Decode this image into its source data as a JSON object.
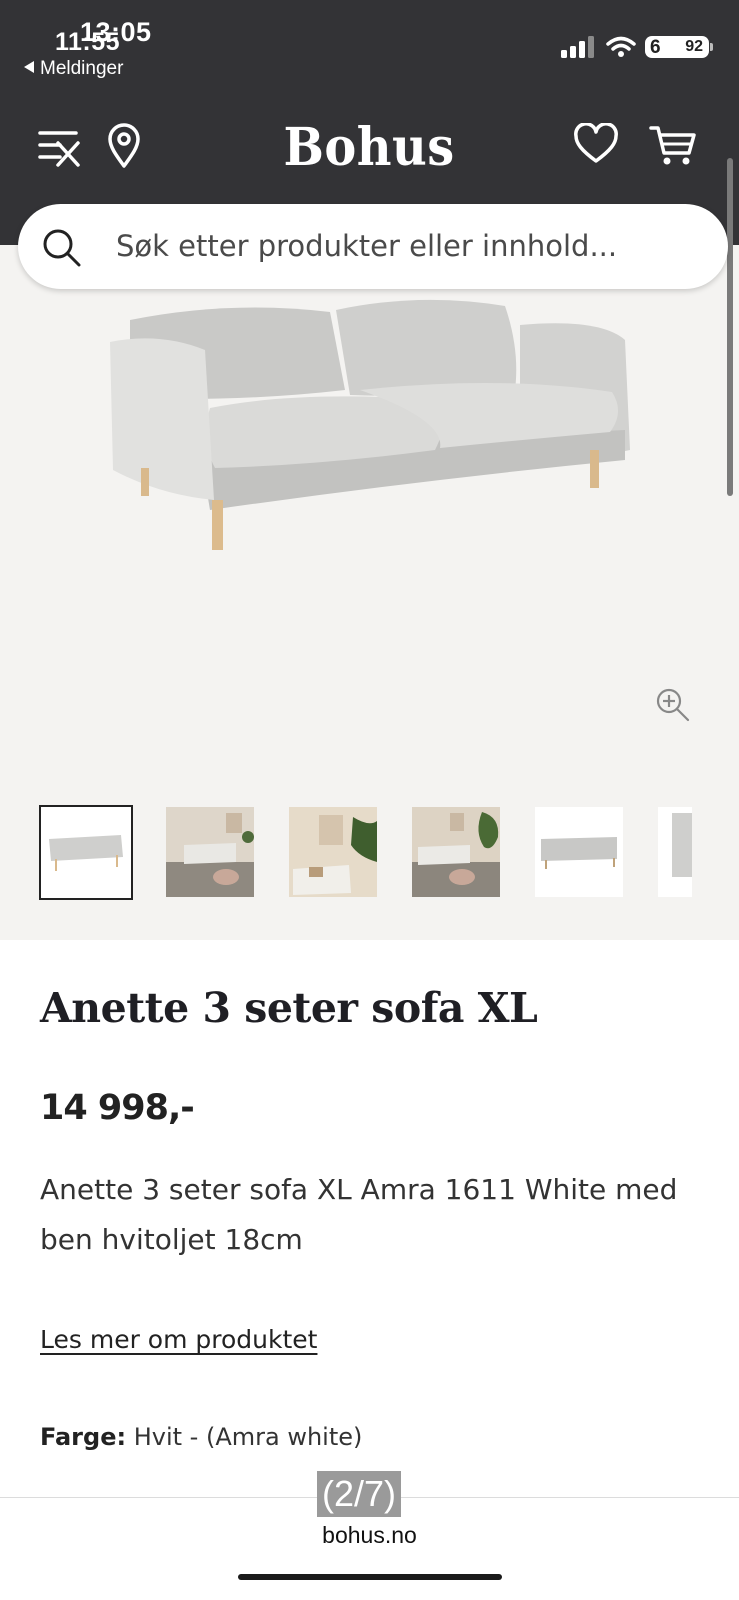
{
  "status_bar": {
    "time_main": "11:55",
    "time_overlay": "13:05",
    "back_app": "Meldinger",
    "battery_level": "92",
    "battery_overlay": "6"
  },
  "header": {
    "logo": "Bohus",
    "icons": [
      "menu-close-icon",
      "location-pin-icon",
      "heart-icon",
      "cart-icon"
    ]
  },
  "search": {
    "placeholder": "Søk etter produkter eller innhold..."
  },
  "gallery": {
    "active_index": 0,
    "thumbnail_count": 6
  },
  "product": {
    "name": "Anette 3 seter sofa XL",
    "price": "14 998,-",
    "description": "Anette 3 seter sofa XL Amra 1611 White med ben hvitoljet 18cm",
    "more_link": "Les mer om produktet",
    "color_label": "Farge:",
    "color_value": "Hvit - (Amra white)"
  },
  "browser": {
    "page_counter": "(2/7)",
    "domain": "bohus.no"
  },
  "colors": {
    "header_bg": "#333336",
    "hero_bg": "#f4f3f1",
    "text_dark": "#1f1f24"
  }
}
